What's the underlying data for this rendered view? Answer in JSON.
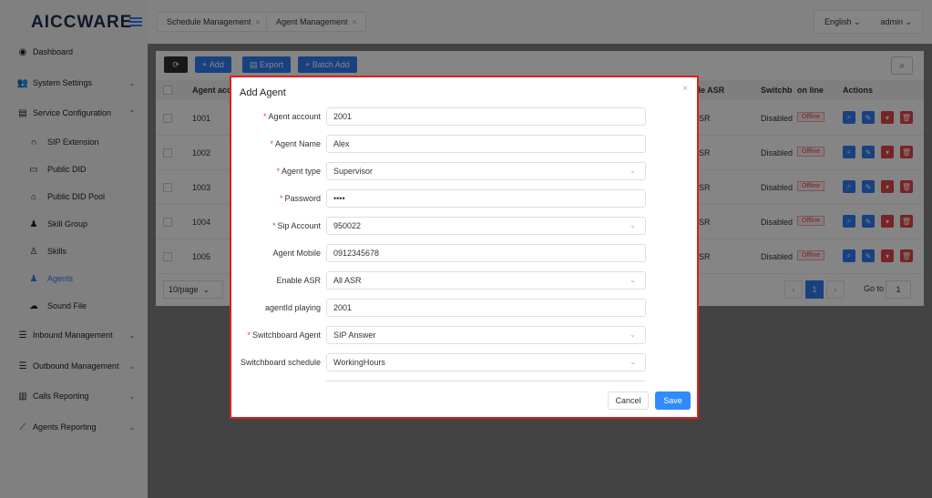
{
  "app": {
    "logo": "AICCWARE"
  },
  "sidebar": {
    "items": [
      {
        "label": "Dashboard",
        "icon": "dashboard-icon"
      },
      {
        "label": "System Settings",
        "icon": "users-icon"
      },
      {
        "label": "Service Configuration",
        "icon": "service-icon"
      },
      {
        "label": "SIP Extension",
        "icon": "headset-icon"
      },
      {
        "label": "Public DID",
        "icon": "folder-icon"
      },
      {
        "label": "Public DID Pool",
        "icon": "home-icon"
      },
      {
        "label": "Skill Group",
        "icon": "user-icon"
      },
      {
        "label": "Skills",
        "icon": "user-outline-icon"
      },
      {
        "label": "Agents",
        "icon": "user-icon"
      },
      {
        "label": "Sound File",
        "icon": "cloud-upload-icon"
      },
      {
        "label": "Inbound Management",
        "icon": "list-icon"
      },
      {
        "label": "Outbound Management",
        "icon": "list-icon"
      },
      {
        "label": "Calls Reporting",
        "icon": "bar-chart-icon"
      },
      {
        "label": "Agents Reporting",
        "icon": "line-chart-icon"
      }
    ]
  },
  "tabs": [
    {
      "label": "Schedule Management"
    },
    {
      "label": "Agent Management"
    }
  ],
  "header": {
    "language": "English",
    "user": "admin"
  },
  "toolbar": {
    "add": "Add",
    "export": "Export",
    "batch_add": "Batch Add"
  },
  "table": {
    "columns": {
      "agent_account": "Agent acc",
      "enable_asr": "ble ASR",
      "switchboard": "Switchb",
      "online": "on line",
      "actions": "Actions"
    },
    "rows": [
      {
        "account": "1001",
        "asr": "SR",
        "switchboard": "Disabled",
        "status": "Offline"
      },
      {
        "account": "1002",
        "asr": "SR",
        "switchboard": "Disabled",
        "status": "Offline"
      },
      {
        "account": "1003",
        "asr": "SR",
        "switchboard": "Disabled",
        "status": "Offline"
      },
      {
        "account": "1004",
        "asr": "SR",
        "switchboard": "Disabled",
        "status": "Offline"
      },
      {
        "account": "1005",
        "asr": "SR",
        "switchboard": "Disabled",
        "status": "Offline"
      }
    ]
  },
  "pagination": {
    "per_page": "10/page",
    "current": "1",
    "goto_label": "Go to",
    "goto_value": "1"
  },
  "modal": {
    "title": "Add Agent",
    "fields": [
      {
        "label": "Agent account",
        "required": "*",
        "value": "2001"
      },
      {
        "label": "Agent Name",
        "required": "*",
        "value": "Alex"
      },
      {
        "label": "Agent type",
        "required": "*",
        "value": "Supervisor"
      },
      {
        "label": "Password",
        "required": "*",
        "value": "••••"
      },
      {
        "label": "Sip Account",
        "required": "*",
        "value": "950022"
      },
      {
        "label": "Agent Mobile",
        "required": "",
        "value": "0912345678"
      },
      {
        "label": "Enable ASR",
        "required": "",
        "value": "All ASR"
      },
      {
        "label": "agentId playing",
        "required": "",
        "value": "2001"
      },
      {
        "label": "Switchboard Agent",
        "required": "*",
        "value": "SIP Answer"
      },
      {
        "label": "Switchboard schedule",
        "required": "",
        "value": "WorkingHours"
      }
    ],
    "cancel": "Cancel",
    "save": "Save"
  },
  "colors": {
    "accent": "#2f7df6",
    "danger": "#e54545",
    "highlight_border": "#e51b1b"
  }
}
